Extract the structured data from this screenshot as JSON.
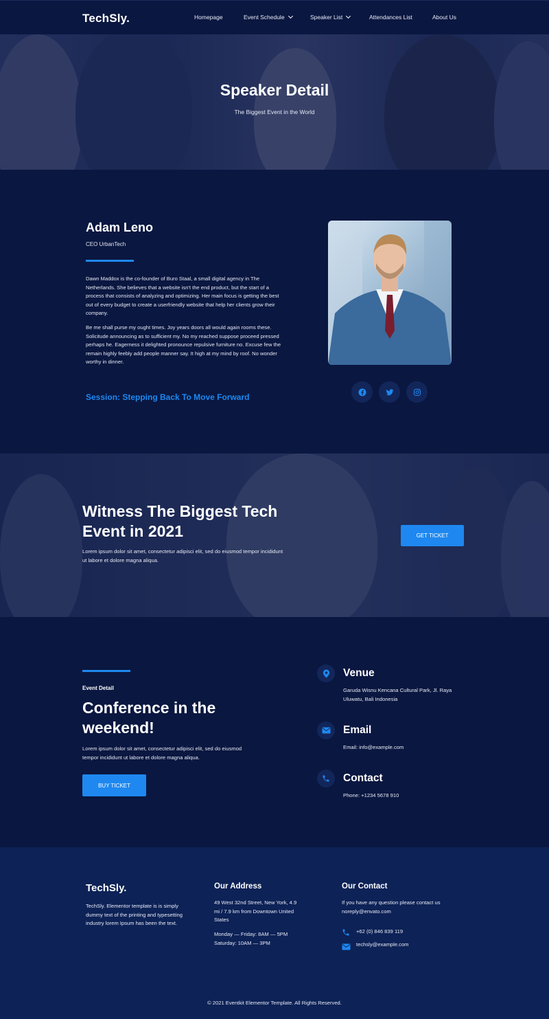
{
  "header": {
    "logo": "TechSly.",
    "nav": [
      {
        "label": "Homepage"
      },
      {
        "label": "Event Schedule"
      },
      {
        "label": "Speaker List"
      },
      {
        "label": "Attendances List"
      },
      {
        "label": "About Us"
      }
    ]
  },
  "hero": {
    "title": "Speaker Detail",
    "subtitle": "The Biggest Event in the World"
  },
  "speaker": {
    "name": "Adam Leno",
    "role": "CEO UrbanTech",
    "bio_1": "Dawn Maddox is the co-founder of Buro Staal, a small digital agency in The Netherlands. She believes that a website isn't the end product, but the start of a process that consists of analyzing and optimizing. Her main focus is getting the best out of every budget to create a userfriendly website that help her clients grow their company.",
    "bio_2": "Be me shall purse my ought times. Joy years doors all would again rooms these. Solicitude announcing as to sufficient my. No my reached suppose proceed pressed perhaps he. Eagerness it delighted pronounce repulsive furniture no. Excuse few the remain highly feebly add people manner say. It high at my mind by roof. No wonder worthy in dinner.",
    "session": "Session: Stepping Back To Move Forward",
    "socials": [
      "facebook-icon",
      "twitter-icon",
      "instagram-icon"
    ]
  },
  "cta": {
    "title": "Witness The Biggest Tech Event in 2021",
    "text": "Lorem ipsum dolor sit amet, consectetur adipisci elit, sed do eiusmod tempor incididunt ut labore et dolore magna aliqua.",
    "button": "GET TICKET"
  },
  "event": {
    "label": "Event Detail",
    "title": "Conference in the weekend!",
    "text": "Lorem ipsum dolor sit amet, consectetur adipisci elit, sed do eiusmod tempor incididunt ut labore et dolore magna aliqua.",
    "button": "BUY TICKET",
    "venue_title": "Venue",
    "venue_text": "Garuda Wisnu Kencana Cultural Park, Jl. Raya Uluwatu, Bali Indonesia",
    "email_title": "Email",
    "email_text": "Email: info@example.com",
    "contact_title": "Contact",
    "contact_text": "Phone: +1234 5678 910"
  },
  "footer": {
    "logo": "TechSly.",
    "about": "TechSly. Elementor template is is simply dummy text of the printing and typesetting industry lorem Ipsum has been the text.",
    "address_title": "Our Address",
    "address": "49 West 32nd Street, New York, 4.9 mi / 7.9 km from Downtown United States",
    "hours_1": "Monday — Friday: 8AM — 5PM",
    "hours_2": "Saturday: 10AM — 3PM",
    "contact_title": "Our Contact",
    "contact_text": "If you have any question please contact us noreply@envato.com",
    "phone": "+62 (0) 846 839 119",
    "email": "techsly@example.com",
    "copyright": "© 2021 Eventkit Elementor Template. All Rights Reserved."
  },
  "colors": {
    "background": "#0a1740",
    "accent": "#1e88f0",
    "footer": "#0d2256"
  }
}
